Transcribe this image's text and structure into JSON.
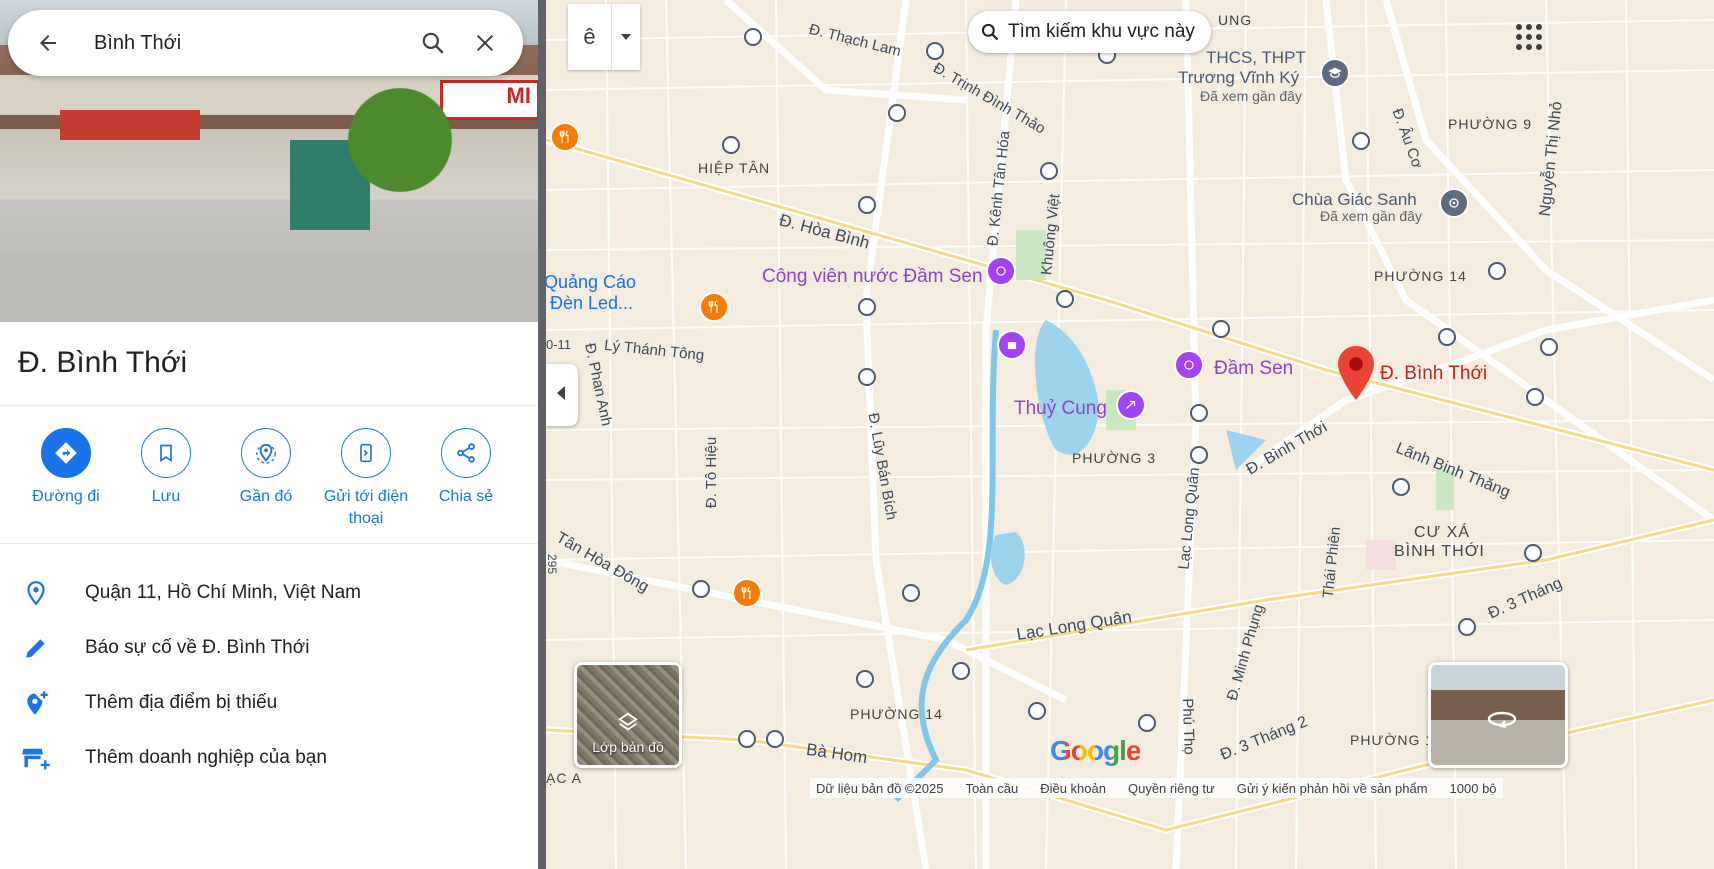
{
  "search": {
    "query": "Bình Thới"
  },
  "place": {
    "title": "Đ. Bình Thới"
  },
  "actions": [
    {
      "label": "Đường đi"
    },
    {
      "label": "Lưu"
    },
    {
      "label": "Gần đó"
    },
    {
      "label": "Gửi tới điện thoại"
    },
    {
      "label": "Chia sẻ"
    }
  ],
  "info_rows": [
    {
      "text": "Quận 11, Hồ Chí Minh, Việt Nam",
      "icon": "location-pin-icon"
    },
    {
      "text": "Báo sự cố về Đ. Bình Thới",
      "icon": "pencil-icon"
    },
    {
      "text": "Thêm địa điểm bị thiếu",
      "icon": "add-location-icon"
    },
    {
      "text": "Thêm doanh nghiệp của bạn",
      "icon": "add-business-icon"
    }
  ],
  "hero": {
    "storefront_text": "MI"
  },
  "map": {
    "search_area_button": "Tìm kiếm khu vực này",
    "input_tool_glyph": "ê",
    "layers_label": "Lớp bản đồ",
    "google_logo": "Google",
    "footer": {
      "data": "Dữ liệu bản đồ ©2025",
      "global": "Toàn cầu",
      "terms": "Điều khoản",
      "privacy": "Quyền riêng tư",
      "feedback": "Gửi ý kiến phản hồi về sản phẩm",
      "scale": "1000 bộ"
    },
    "labels": {
      "thach_lam": "Đ. Thạch Lam",
      "trinh_dinh_thao": "Đ. Trịnh Đình Thảo",
      "hiep_tan": "HIỆP TÂN",
      "hoa_binh": "Đ. Hòa Bình",
      "kenh_tan_hoa": "Đ. Kênh Tân Hóa",
      "khuong_viet": "Khuông Việt",
      "cong_vien": "Công viên nước Đầm Sen",
      "quang_cao_1": "Quảng Cáo",
      "quang_cao_2": "Đèn Led...",
      "ly_thanh_tong": "Lý Thánh Tông",
      "phan_anh": "Đ. Phan Anh",
      "road_0_11": "0-11",
      "to_hieu": "Đ. Tô Hiệu",
      "luy_ban_bich": "Đ. Lũy Bán Bích",
      "tan_hoa_dong": "Tân Hòa Đông",
      "n295": "295",
      "thuy_cung": "Thuỷ Cung",
      "dam_sen": "Đầm Sen",
      "phuong_3": "PHƯỜNG 3",
      "lac_long_quan_v": "Lạc Long Quân",
      "lac_long_quan_h": "Lạc Long Quân",
      "minh_phung": "Đ. Minh Phụng",
      "thai_phien": "Thái Phiên",
      "binh_thoi_road": "Đ. Bình Thới",
      "binh_thoi_pin": "Đ. Bình Thới",
      "lanh_binh_thang": "Lãnh Binh Thăng",
      "cu_xa_1": "CƯ XÁ",
      "cu_xa_2": "BÌNH THỚI",
      "phuong_14a": "PHƯỜNG 14",
      "phuong_14b": "PHƯỜNG 14",
      "phuong_9": "PHƯỜNG 9",
      "phuong_1": "PHƯỜNG 1",
      "au_co": "Đ. Âu Cơ",
      "chua": "Chùa Giác Sanh",
      "chua_seen": "Đã xem gần đây",
      "thcs_1": "THCS, THPT",
      "thcs_2": "Trương Vĩnh Ký",
      "thcs_seen": "Đã xem gần đây",
      "nguyen_thi_nho": "Nguyễn Thị Nhỏ",
      "ung": "UNG",
      "ba_hom": "Bà Hom",
      "phu_tho": "Phú Thọ",
      "ba_thang_2": "Đ. 3 Tháng 2",
      "ba_thang_2b": "Đ. 3 Tháng",
      "ac_a": "ẠC A"
    },
    "colors": {
      "accent": "#1a73e8",
      "pin": "#ea4335",
      "poi_purple": "#8e44c9",
      "poi_food": "#f57c00"
    }
  }
}
